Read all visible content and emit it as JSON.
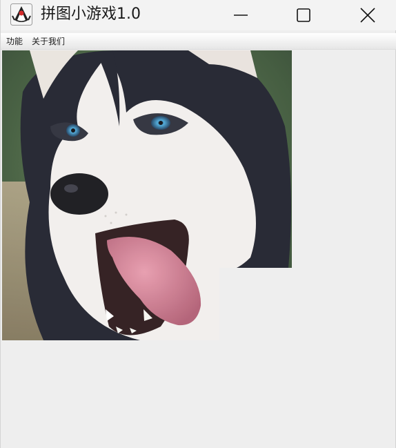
{
  "window": {
    "title": "拼图小游戏1.0",
    "app_icon": "java-duke-icon",
    "controls": {
      "minimize_icon": "minimize-icon",
      "maximize_icon": "maximize-icon",
      "close_icon": "close-icon"
    }
  },
  "menubar": {
    "items": [
      {
        "label": "功能"
      },
      {
        "label": "关于我们"
      }
    ]
  },
  "puzzle": {
    "grid": "4x4",
    "image": "husky-dog-photo",
    "blank_tile": {
      "row": 4,
      "col": 4
    }
  },
  "colors": {
    "background": "#eeeeee",
    "titlebar": "#f3f3f3"
  }
}
